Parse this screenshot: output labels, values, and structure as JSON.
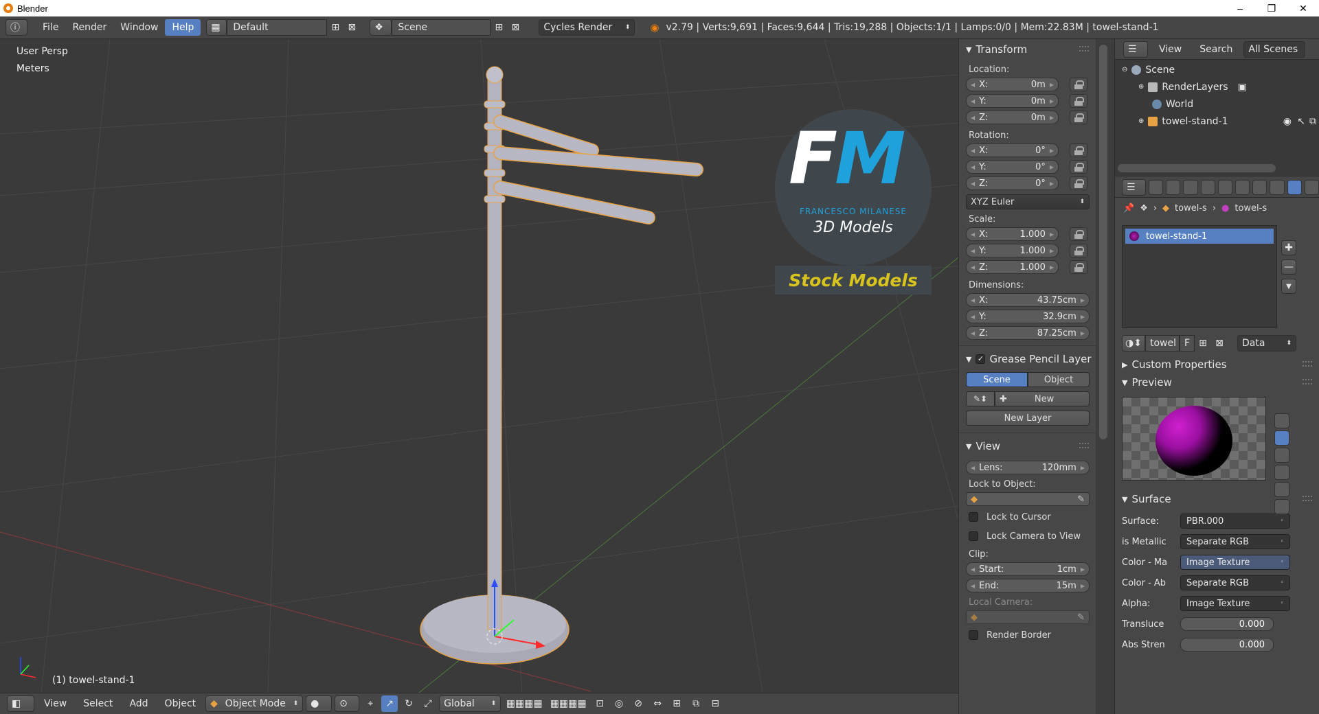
{
  "window": {
    "title": "Blender",
    "controls": [
      "–",
      "❐",
      "✕"
    ]
  },
  "menu": {
    "items": [
      "File",
      "Render",
      "Window",
      "Help"
    ],
    "active": "Help"
  },
  "screen_layout": "Default",
  "scene_name": "Scene",
  "render_engine": "Cycles Render",
  "stats": "v2.79 | Verts:9,691 | Faces:9,644 | Tris:19,288 | Objects:1/1 | Lamps:0/0 | Mem:22.83M | towel-stand-1",
  "viewport": {
    "view_name": "User Persp",
    "units": "Meters",
    "object_label": "(1) towel-stand-1",
    "logo": {
      "fm_f": "F",
      "fm_m": "M",
      "name": "FRANCESCO MILANESE",
      "sub": "3D Models",
      "banner": "Stock Models"
    }
  },
  "viewport_header": {
    "menus": [
      "View",
      "Select",
      "Add",
      "Object"
    ],
    "mode": "Object Mode",
    "orientation": "Global"
  },
  "transform": {
    "title": "Transform",
    "location_label": "Location:",
    "location": [
      {
        "k": "X:",
        "v": "0m"
      },
      {
        "k": "Y:",
        "v": "0m"
      },
      {
        "k": "Z:",
        "v": "0m"
      }
    ],
    "rotation_label": "Rotation:",
    "rotation": [
      {
        "k": "X:",
        "v": "0°"
      },
      {
        "k": "Y:",
        "v": "0°"
      },
      {
        "k": "Z:",
        "v": "0°"
      }
    ],
    "rotation_mode": "XYZ Euler",
    "scale_label": "Scale:",
    "scale": [
      {
        "k": "X:",
        "v": "1.000"
      },
      {
        "k": "Y:",
        "v": "1.000"
      },
      {
        "k": "Z:",
        "v": "1.000"
      }
    ],
    "dimensions_label": "Dimensions:",
    "dimensions": [
      {
        "k": "X:",
        "v": "43.75cm"
      },
      {
        "k": "Y:",
        "v": "32.9cm"
      },
      {
        "k": "Z:",
        "v": "87.25cm"
      }
    ]
  },
  "grease_pencil": {
    "title": "Grease Pencil Layer",
    "tab_scene": "Scene",
    "tab_object": "Object",
    "new_label": "New",
    "new_layer_label": "New Layer"
  },
  "view_panel": {
    "title": "View",
    "lens_label": "Lens:",
    "lens_value": "120mm",
    "lock_object_label": "Lock to Object:",
    "lock_cursor": "Lock to Cursor",
    "lock_camera": "Lock Camera to View",
    "clip_label": "Clip:",
    "clip_start_label": "Start:",
    "clip_start": "1cm",
    "clip_end_label": "End:",
    "clip_end": "15m",
    "local_camera": "Local Camera:",
    "render_border": "Render Border"
  },
  "outliner": {
    "menus": [
      "View",
      "Search"
    ],
    "filter": "All Scenes",
    "tree": [
      "Scene",
      "RenderLayers",
      "World",
      "towel-stand-1"
    ]
  },
  "properties": {
    "breadcrumb": [
      "towel-s",
      "towel-s"
    ],
    "material_slot": "towel-stand-1",
    "material_name": "towel",
    "fake_user": "F",
    "link": "Data",
    "custom_props": "Custom Properties",
    "preview": "Preview",
    "surface_title": "Surface",
    "surface_rows": [
      {
        "label": "Surface:",
        "value": "PBR.000"
      },
      {
        "label": "is Metallic",
        "value": "Separate RGB"
      },
      {
        "label": "Color - Ma",
        "value": "Image Texture"
      },
      {
        "label": "Color - Ab",
        "value": "Separate RGB"
      },
      {
        "label": "Alpha:",
        "value": "Image Texture"
      }
    ],
    "value_rows": [
      {
        "label": "Transluce",
        "value": "0.000"
      },
      {
        "label": "Abs Stren",
        "value": "0.000"
      }
    ]
  },
  "colors": {
    "accent": "#5680c2",
    "selection": "#e8a244",
    "logo_blue": "#1fa1dc",
    "banner_yellow": "#d8c41c"
  }
}
